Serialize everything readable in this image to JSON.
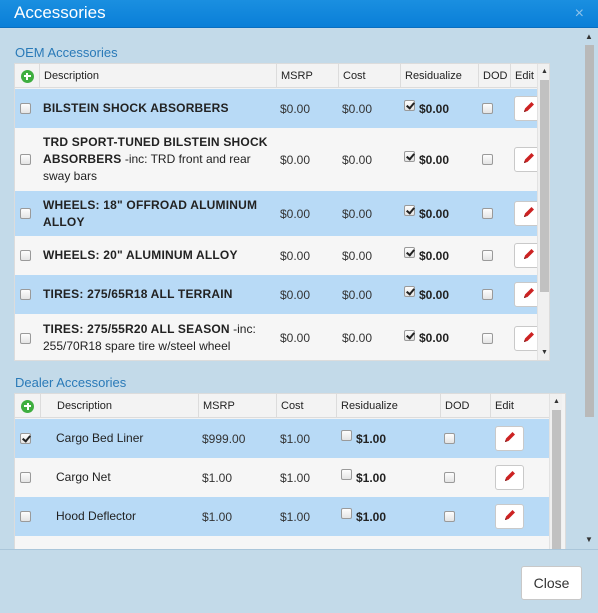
{
  "dialog": {
    "title": "Accessories",
    "close_glyph": "×"
  },
  "oem": {
    "section_title": "OEM Accessories",
    "headers": {
      "description": "Description",
      "msrp": "MSRP",
      "cost": "Cost",
      "residualize": "Residualize",
      "dod": "DOD",
      "edit": "Edit"
    },
    "rows": [
      {
        "title": "BILSTEIN SHOCK ABSORBERS",
        "detail": "",
        "msrp": "$0.00",
        "cost": "$0.00",
        "residualize_checked": true,
        "residual_value": "$0.00",
        "dod_checked": false,
        "selected": false
      },
      {
        "title": "TRD SPORT-TUNED BILSTEIN SHOCK ABSORBERS",
        "detail": " -inc: TRD front and rear sway bars",
        "msrp": "$0.00",
        "cost": "$0.00",
        "residualize_checked": true,
        "residual_value": "$0.00",
        "dod_checked": false,
        "selected": false
      },
      {
        "title": "WHEELS: 18\" OFFROAD ALUMINUM ALLOY",
        "detail": "",
        "msrp": "$0.00",
        "cost": "$0.00",
        "residualize_checked": true,
        "residual_value": "$0.00",
        "dod_checked": false,
        "selected": false
      },
      {
        "title": "WHEELS: 20\" ALUMINUM ALLOY",
        "detail": "",
        "msrp": "$0.00",
        "cost": "$0.00",
        "residualize_checked": true,
        "residual_value": "$0.00",
        "dod_checked": false,
        "selected": false
      },
      {
        "title": "TIRES: 275/65R18 ALL TERRAIN",
        "detail": "",
        "msrp": "$0.00",
        "cost": "$0.00",
        "residualize_checked": true,
        "residual_value": "$0.00",
        "dod_checked": false,
        "selected": false
      },
      {
        "title": "TIRES: 275/55R20 ALL SEASON",
        "detail": " -inc: 255/70R18 spare tire w/steel wheel",
        "msrp": "$0.00",
        "cost": "$0.00",
        "residualize_checked": true,
        "residual_value": "$0.00",
        "dod_checked": false,
        "selected": false
      }
    ]
  },
  "dealer": {
    "section_title": "Dealer Accessories",
    "headers": {
      "description": "Description",
      "msrp": "MSRP",
      "cost": "Cost",
      "residualize": "Residualize",
      "dod": "DOD",
      "edit": "Edit"
    },
    "rows": [
      {
        "description": "Cargo Bed Liner",
        "msrp": "$999.00",
        "cost": "$1.00",
        "residualize_checked": false,
        "residual_value": "$1.00",
        "dod_checked": false,
        "selected": true
      },
      {
        "description": "Cargo Net",
        "msrp": "$1.00",
        "cost": "$1.00",
        "residualize_checked": false,
        "residual_value": "$1.00",
        "dod_checked": false,
        "selected": false
      },
      {
        "description": "Hood Deflector",
        "msrp": "$1.00",
        "cost": "$1.00",
        "residualize_checked": false,
        "residual_value": "$1.00",
        "dod_checked": false,
        "selected": false
      }
    ]
  },
  "footer": {
    "close_label": "Close"
  },
  "colors": {
    "title_bar": "#0a84dd",
    "row_blue": "#b8daf6",
    "accent_green": "#3fae3f",
    "pencil_red": "#cc2222"
  }
}
